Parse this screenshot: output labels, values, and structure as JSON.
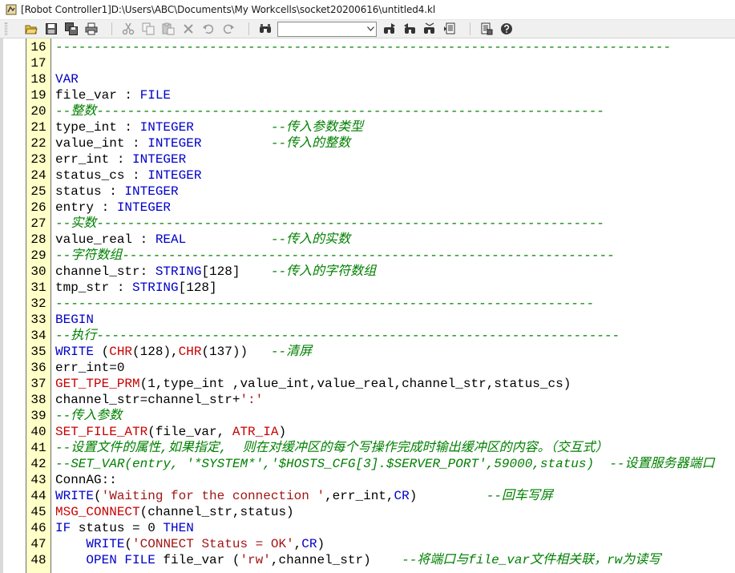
{
  "window": {
    "title": "[Robot Controller1]D:\\Users\\ABC\\Documents\\My Workcells\\socket20200616\\untitled4.kl"
  },
  "toolbar": {
    "buttons": [
      {
        "name": "open-icon"
      },
      {
        "name": "save-icon"
      },
      {
        "name": "save-all-icon"
      },
      {
        "name": "print-icon"
      },
      {
        "name": "cut-icon"
      },
      {
        "name": "copy-icon"
      },
      {
        "name": "paste-icon"
      },
      {
        "name": "delete-icon"
      },
      {
        "name": "undo-icon"
      },
      {
        "name": "redo-icon"
      },
      {
        "name": "find-icon"
      },
      {
        "name": "find-next-icon"
      },
      {
        "name": "find-prev-icon"
      },
      {
        "name": "replace-icon"
      },
      {
        "name": "goto-icon"
      },
      {
        "name": "properties-icon"
      },
      {
        "name": "help-icon"
      }
    ],
    "find_value": ""
  },
  "colors": {
    "keyword": "#0000c8",
    "builtin": "#c80000",
    "string": "#a31515",
    "comment": "#008000",
    "gutter": "#ffffc8"
  },
  "editor": {
    "lines": [
      {
        "num": "16",
        "tokens": [
          {
            "t": "cm",
            "v": "--------------------------------------------------------------------------------"
          }
        ]
      },
      {
        "num": "17",
        "tokens": []
      },
      {
        "num": "18",
        "tokens": [
          {
            "t": "kw",
            "v": "VAR"
          }
        ]
      },
      {
        "num": "19",
        "tokens": [
          {
            "t": "plain",
            "v": "file_var : "
          },
          {
            "t": "kw",
            "v": "FILE"
          }
        ]
      },
      {
        "num": "20",
        "tokens": [
          {
            "t": "cm",
            "v": "--整数------------------------------------------------------------------"
          }
        ]
      },
      {
        "num": "21",
        "tokens": [
          {
            "t": "plain",
            "v": "type_int : "
          },
          {
            "t": "kw",
            "v": "INTEGER"
          },
          {
            "t": "plain",
            "v": "          "
          },
          {
            "t": "cm",
            "v": "--传入参数类型"
          }
        ]
      },
      {
        "num": "22",
        "tokens": [
          {
            "t": "plain",
            "v": "value_int : "
          },
          {
            "t": "kw",
            "v": "INTEGER"
          },
          {
            "t": "plain",
            "v": "         "
          },
          {
            "t": "cm",
            "v": "--传入的整数"
          }
        ]
      },
      {
        "num": "23",
        "tokens": [
          {
            "t": "plain",
            "v": "err_int : "
          },
          {
            "t": "kw",
            "v": "INTEGER"
          }
        ]
      },
      {
        "num": "24",
        "tokens": [
          {
            "t": "plain",
            "v": "status_cs : "
          },
          {
            "t": "kw",
            "v": "INTEGER"
          }
        ]
      },
      {
        "num": "25",
        "tokens": [
          {
            "t": "plain",
            "v": "status : "
          },
          {
            "t": "kw",
            "v": "INTEGER"
          }
        ]
      },
      {
        "num": "26",
        "tokens": [
          {
            "t": "plain",
            "v": "entry : "
          },
          {
            "t": "kw",
            "v": "INTEGER"
          }
        ]
      },
      {
        "num": "27",
        "tokens": [
          {
            "t": "cm",
            "v": "--实数------------------------------------------------------------------"
          }
        ]
      },
      {
        "num": "28",
        "tokens": [
          {
            "t": "plain",
            "v": "value_real : "
          },
          {
            "t": "kw",
            "v": "REAL"
          },
          {
            "t": "plain",
            "v": "           "
          },
          {
            "t": "cm",
            "v": "--传入的实数"
          }
        ]
      },
      {
        "num": "29",
        "tokens": [
          {
            "t": "cm",
            "v": "--字符数组----------------------------------------------------------------"
          }
        ]
      },
      {
        "num": "30",
        "tokens": [
          {
            "t": "plain",
            "v": "channel_str: "
          },
          {
            "t": "kw",
            "v": "STRING"
          },
          {
            "t": "plain",
            "v": "[128]    "
          },
          {
            "t": "cm",
            "v": "--传入的字符数组"
          }
        ]
      },
      {
        "num": "31",
        "tokens": [
          {
            "t": "plain",
            "v": "tmp_str : "
          },
          {
            "t": "kw",
            "v": "STRING"
          },
          {
            "t": "plain",
            "v": "[128]"
          }
        ]
      },
      {
        "num": "32",
        "tokens": [
          {
            "t": "cm",
            "v": "----------------------------------------------------------------------"
          }
        ]
      },
      {
        "num": "33",
        "tokens": [
          {
            "t": "kw",
            "v": "BEGIN"
          }
        ]
      },
      {
        "num": "34",
        "tokens": [
          {
            "t": "cm",
            "v": "--执行--------------------------------------------------------------------"
          }
        ]
      },
      {
        "num": "35",
        "tokens": [
          {
            "t": "kw",
            "v": "WRITE"
          },
          {
            "t": "plain",
            "v": " ("
          },
          {
            "t": "fn",
            "v": "CHR"
          },
          {
            "t": "plain",
            "v": "(128),"
          },
          {
            "t": "fn",
            "v": "CHR"
          },
          {
            "t": "plain",
            "v": "(137))   "
          },
          {
            "t": "cm",
            "v": "--清屏"
          }
        ]
      },
      {
        "num": "36",
        "tokens": [
          {
            "t": "plain",
            "v": "err_int=0"
          }
        ]
      },
      {
        "num": "37",
        "tokens": [
          {
            "t": "fn",
            "v": "GET_TPE_PRM"
          },
          {
            "t": "plain",
            "v": "(1,type_int ,value_int,value_real,channel_str,status_cs)"
          }
        ]
      },
      {
        "num": "38",
        "tokens": [
          {
            "t": "plain",
            "v": "channel_str=channel_str+"
          },
          {
            "t": "str",
            "v": "':'"
          }
        ]
      },
      {
        "num": "39",
        "tokens": [
          {
            "t": "cm",
            "v": "--传入参数"
          }
        ]
      },
      {
        "num": "40",
        "tokens": [
          {
            "t": "fn",
            "v": "SET_FILE_ATR"
          },
          {
            "t": "plain",
            "v": "(file_var, "
          },
          {
            "t": "fn",
            "v": "ATR_IA"
          },
          {
            "t": "plain",
            "v": ")"
          }
        ]
      },
      {
        "num": "41",
        "tokens": [
          {
            "t": "cm",
            "v": "--设置文件的属性,如果指定,  则在对缓冲区的每个写操作完成时输出缓冲区的内容。（交互式）"
          }
        ]
      },
      {
        "num": "42",
        "tokens": [
          {
            "t": "cm",
            "v": "--SET_VAR(entry, '*SYSTEM*','$HOSTS_CFG[3].$SERVER_PORT',59000,status)  --设置服务器端口"
          }
        ]
      },
      {
        "num": "43",
        "tokens": [
          {
            "t": "plain",
            "v": "ConnAG::"
          }
        ]
      },
      {
        "num": "44",
        "tokens": [
          {
            "t": "kw",
            "v": "WRITE"
          },
          {
            "t": "plain",
            "v": "("
          },
          {
            "t": "str",
            "v": "'Waiting for the connection '"
          },
          {
            "t": "plain",
            "v": ",err_int,"
          },
          {
            "t": "kw",
            "v": "CR"
          },
          {
            "t": "plain",
            "v": ")         "
          },
          {
            "t": "cm",
            "v": "--回车写屏"
          }
        ]
      },
      {
        "num": "45",
        "tokens": [
          {
            "t": "fn",
            "v": "MSG_CONNECT"
          },
          {
            "t": "plain",
            "v": "(channel_str,status)"
          }
        ]
      },
      {
        "num": "46",
        "tokens": [
          {
            "t": "kw",
            "v": "IF"
          },
          {
            "t": "plain",
            "v": " status = 0 "
          },
          {
            "t": "kw",
            "v": "THEN"
          }
        ]
      },
      {
        "num": "47",
        "tokens": [
          {
            "t": "plain",
            "v": "    "
          },
          {
            "t": "kw",
            "v": "WRITE"
          },
          {
            "t": "plain",
            "v": "("
          },
          {
            "t": "str",
            "v": "'CONNECT Status = OK'"
          },
          {
            "t": "plain",
            "v": ","
          },
          {
            "t": "kw",
            "v": "CR"
          },
          {
            "t": "plain",
            "v": ")"
          }
        ]
      },
      {
        "num": "48",
        "tokens": [
          {
            "t": "plain",
            "v": "    "
          },
          {
            "t": "kw",
            "v": "OPEN FILE"
          },
          {
            "t": "plain",
            "v": " file_var ("
          },
          {
            "t": "str",
            "v": "'rw'"
          },
          {
            "t": "plain",
            "v": ",channel_str)    "
          },
          {
            "t": "cm",
            "v": "--将端口与file_var文件相关联，rw为读写"
          }
        ]
      }
    ]
  }
}
